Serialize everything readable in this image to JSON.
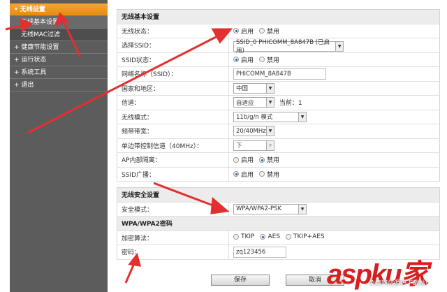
{
  "sidebar": {
    "items": [
      {
        "label": "• 无线设置"
      },
      {
        "label": "无线基本设置"
      },
      {
        "label": "无线MAC过滤"
      },
      {
        "label": "+ 健康节能设置"
      },
      {
        "label": "+ 运行状态"
      },
      {
        "label": "+ 系统工具"
      },
      {
        "label": "+ 退出"
      }
    ]
  },
  "basic": {
    "title": "无线基本设置",
    "wireless_status": {
      "label": "无线状态：",
      "on": "启用",
      "off": "禁用"
    },
    "ssid_select": {
      "label": "选择SSID：",
      "value": "SSID_0 PHICOMM_8A847B (已启用)"
    },
    "ssid_status": {
      "label": "SSID状态：",
      "on": "启用",
      "off": "禁用"
    },
    "ssid_name": {
      "label": "网络名称（SSID）：",
      "value": "PHICOMM_8A847B"
    },
    "region": {
      "label": "国家和地区：",
      "value": "中国"
    },
    "channel": {
      "label": "信道：",
      "value": "自适应",
      "current": "当前：1"
    },
    "mode": {
      "label": "无线模式：",
      "value": "11b/g/n 模式"
    },
    "bandwidth": {
      "label": "频带带宽：",
      "value": "20/40MHz"
    },
    "sideband": {
      "label": "单边带控制信道（40MHz）：",
      "value": "下"
    },
    "ap_isolation": {
      "label": "AP内部隔离：",
      "on": "启用",
      "off": "禁用"
    },
    "ssid_broadcast": {
      "label": "SSID广播：",
      "on": "启用",
      "off": "禁用"
    }
  },
  "security": {
    "title": "无线安全设置",
    "mode": {
      "label": "安全模式：",
      "value": "WPA/WPA2-PSK"
    },
    "wpa_title": "WPA/WPA2密码",
    "cipher": {
      "label": "加密算法：",
      "options": [
        "TKIP",
        "AES",
        "TKIP+AES"
      ]
    },
    "password": {
      "label": "密码：",
      "value": "zq123456"
    }
  },
  "buttons": {
    "save": "保存",
    "cancel": "取消"
  },
  "watermark": {
    "logo": "aspku家",
    "tagline": "免费网站源码下载站!"
  }
}
